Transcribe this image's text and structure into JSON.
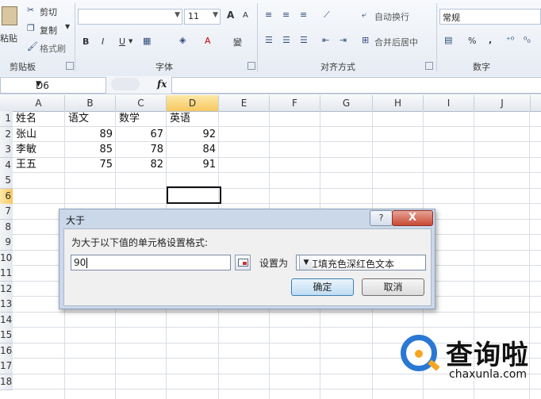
{
  "ribbon": {
    "clipboard": {
      "paste_label": "粘贴",
      "cut_label": "剪切",
      "copy_label": "复制",
      "format_painter_label": "格式刷",
      "group_label": "剪贴板"
    },
    "font": {
      "size_value": "11",
      "bold": "B",
      "italic": "I",
      "underline": "U",
      "grow": "A",
      "shrink": "A",
      "font_color": "A",
      "phonetic": "變",
      "group_label": "字体"
    },
    "alignment": {
      "wrap_text_label": "自动换行",
      "merge_center_label": "合并后居中",
      "group_label": "对齐方式"
    },
    "number": {
      "format_value": "常规",
      "percent": "%",
      "comma": ",",
      "group_label": "数字"
    }
  },
  "formula_bar": {
    "name_box": "D6",
    "fx_label": "fx",
    "formula": ""
  },
  "sheet": {
    "columns": [
      "A",
      "B",
      "C",
      "D",
      "E",
      "F",
      "G",
      "H",
      "I",
      "J"
    ],
    "rows": [
      "1",
      "2",
      "3",
      "4",
      "5",
      "6",
      "7",
      "8",
      "9",
      "10",
      "11",
      "12",
      "13",
      "14",
      "15",
      "16",
      "17",
      "18"
    ],
    "header": [
      "姓名",
      "语文",
      "数学",
      "英语"
    ],
    "data": [
      {
        "name": "张山",
        "chinese": "89",
        "math": "67",
        "english": "92"
      },
      {
        "name": "李敏",
        "chinese": "85",
        "math": "78",
        "english": "84"
      },
      {
        "name": "王五",
        "chinese": "75",
        "math": "82",
        "english": "91"
      }
    ],
    "selected_cell": "D6"
  },
  "dialog": {
    "title": "大于",
    "help": "?",
    "close": "X",
    "instruction": "为大于以下值的单元格设置格式:",
    "value": "90",
    "set_as_label": "设置为",
    "format_option": "浅红填充色深红色文本",
    "ok_label": "确定",
    "cancel_label": "取消"
  },
  "watermark": {
    "text": "查询啦",
    "url": "chaxunla.com"
  },
  "colors": {
    "selection_header": "#f6c860",
    "dialog_frame": "#cad8ea",
    "close_button": "#c84a35",
    "watermark_blue": "#2a78d4",
    "watermark_orange": "#f5a623"
  }
}
